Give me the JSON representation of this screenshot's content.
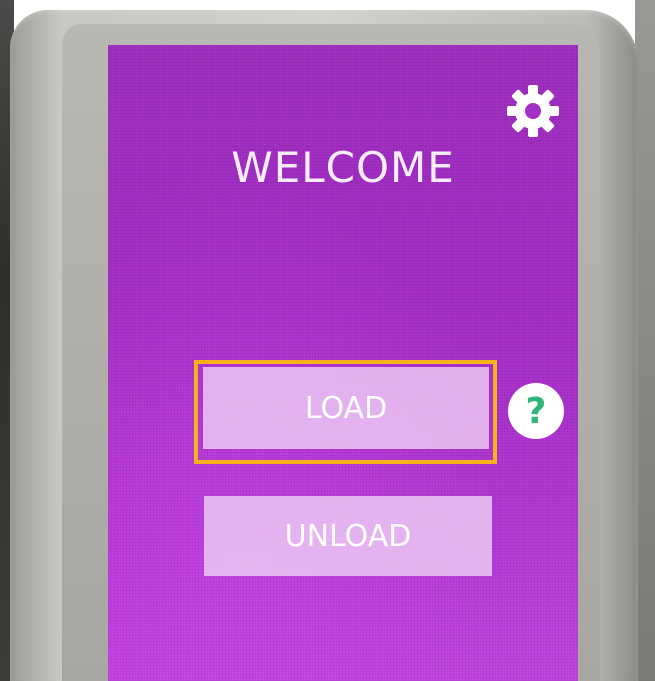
{
  "screen": {
    "title": "WELCOME",
    "settings_icon": "gear-icon",
    "background_color": "#a52ec8"
  },
  "buttons": {
    "load_label": "LOAD",
    "unload_label": "UNLOAD",
    "help_label": "?",
    "help_icon": "question-mark-icon",
    "help_color": "#2fb57c"
  },
  "highlight": {
    "target": "load-button",
    "color": "#f7b11a"
  }
}
